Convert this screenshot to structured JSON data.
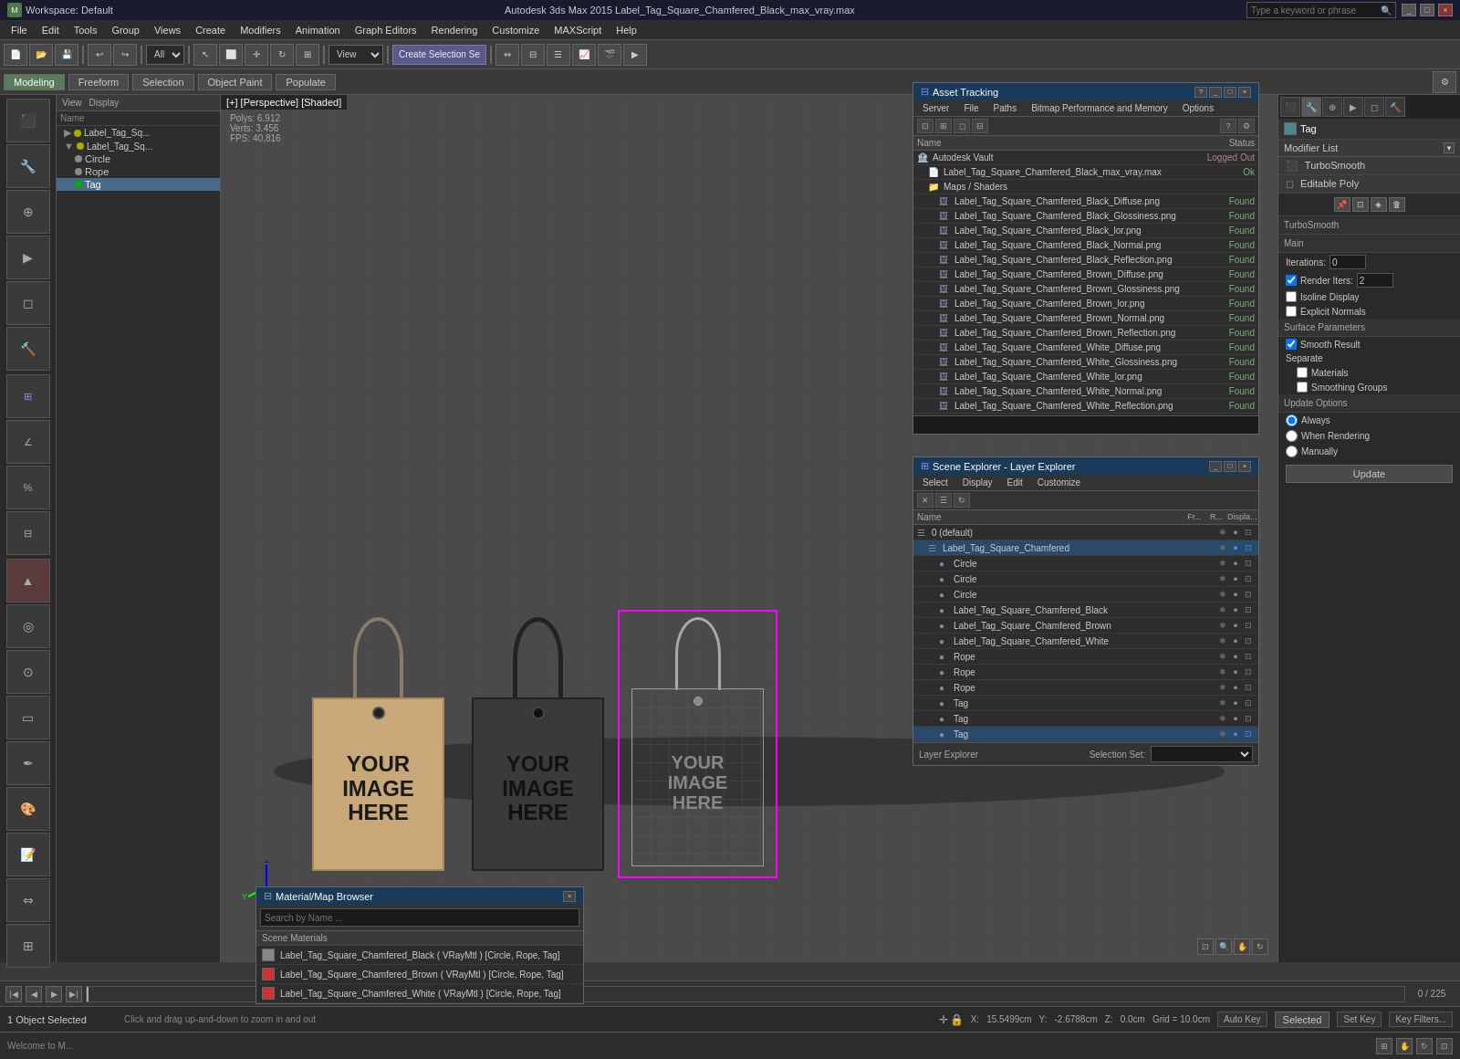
{
  "titleBar": {
    "leftLabel": "Workspace: Default",
    "centerLabel": "Autodesk 3ds Max 2015  Label_Tag_Square_Chamfered_Black_max_vray.max",
    "searchPlaceholder": "Type a keyword or phrase",
    "winBtns": [
      "_",
      "□",
      "×"
    ]
  },
  "menuBar": {
    "items": [
      "File",
      "Edit",
      "Tools",
      "Group",
      "Views",
      "Create",
      "Modifiers",
      "Animation",
      "Graph Editors",
      "Rendering",
      "Customize",
      "MAXScript",
      "Help"
    ]
  },
  "toolbar": {
    "createSelectionLabel": "Create Selection Se",
    "viewLabel": "View",
    "allLabel": "All"
  },
  "tabs": {
    "modeling": "Modeling",
    "freeform": "Freeform",
    "selection": "Selection",
    "objectPaint": "Object Paint",
    "populate": "Populate"
  },
  "scenePanel": {
    "viewLabel": "View",
    "displayLabel": "Display",
    "items": [
      {
        "id": "item1",
        "label": "Label_Tag_Sq...",
        "depth": 0,
        "hasIcon": true
      },
      {
        "id": "item2",
        "label": "Label_Tag_Sq...",
        "depth": 0,
        "hasIcon": true
      },
      {
        "id": "item3",
        "label": "Circle",
        "depth": 2,
        "selected": false
      },
      {
        "id": "item4",
        "label": "Rope",
        "depth": 2,
        "selected": false
      },
      {
        "id": "item5",
        "label": "Tag",
        "depth": 2,
        "selected": true
      }
    ]
  },
  "viewport": {
    "header": "[+] [Perspective] [Shaded]",
    "stats": {
      "polysLabel": "Polys:",
      "polysValue": "6.912",
      "vertsLabel": "Verts:",
      "vertsValue": "3.456",
      "fpsLabel": "FPS:",
      "fpsValue": "40,816"
    },
    "tags": [
      {
        "type": "brown",
        "text": "YOUR\nIMAGE\nHERE"
      },
      {
        "type": "dark",
        "text": "YOUR\nIMAGE\nHERE"
      },
      {
        "type": "wireframe",
        "text": "YOUR\nIMAGE\nHERE"
      }
    ]
  },
  "assetTracking": {
    "title": "Asset Tracking",
    "menuItems": [
      "Server",
      "File",
      "Paths",
      "Bitmap Performance and Memory",
      "Options"
    ],
    "tableHeaders": {
      "name": "Name",
      "status": "Status"
    },
    "rows": [
      {
        "type": "vault",
        "name": "Autodesk Vault",
        "status": "Logged Out",
        "indent": 0
      },
      {
        "type": "file",
        "name": "Label_Tag_Square_Chamfered_Black_max_vray.max",
        "status": "Ok",
        "indent": 1
      },
      {
        "type": "section",
        "name": "Maps / Shaders",
        "status": "",
        "indent": 1
      },
      {
        "type": "map",
        "name": "Label_Tag_Square_Chamfered_Black_Diffuse.png",
        "status": "Found",
        "indent": 2
      },
      {
        "type": "map",
        "name": "Label_Tag_Square_Chamfered_Black_Glossiness.png",
        "status": "Found",
        "indent": 2
      },
      {
        "type": "map",
        "name": "Label_Tag_Square_Chamfered_Black_lor.png",
        "status": "Found",
        "indent": 2
      },
      {
        "type": "map",
        "name": "Label_Tag_Square_Chamfered_Black_Normal.png",
        "status": "Found",
        "indent": 2
      },
      {
        "type": "map",
        "name": "Label_Tag_Square_Chamfered_Black_Reflection.png",
        "status": "Found",
        "indent": 2
      },
      {
        "type": "map",
        "name": "Label_Tag_Square_Chamfered_Brown_Diffuse.png",
        "status": "Found",
        "indent": 2
      },
      {
        "type": "map",
        "name": "Label_Tag_Square_Chamfered_Brown_Glossiness.png",
        "status": "Found",
        "indent": 2
      },
      {
        "type": "map",
        "name": "Label_Tag_Square_Chamfered_Brown_lor.png",
        "status": "Found",
        "indent": 2
      },
      {
        "type": "map",
        "name": "Label_Tag_Square_Chamfered_Brown_Normal.png",
        "status": "Found",
        "indent": 2
      },
      {
        "type": "map",
        "name": "Label_Tag_Square_Chamfered_Brown_Reflection.png",
        "status": "Found",
        "indent": 2
      },
      {
        "type": "map",
        "name": "Label_Tag_Square_Chamfered_White_Diffuse.png",
        "status": "Found",
        "indent": 2
      },
      {
        "type": "map",
        "name": "Label_Tag_Square_Chamfered_White_Glossiness.png",
        "status": "Found",
        "indent": 2
      },
      {
        "type": "map",
        "name": "Label_Tag_Square_Chamfered_White_lor.png",
        "status": "Found",
        "indent": 2
      },
      {
        "type": "map",
        "name": "Label_Tag_Square_Chamfered_White_Normal.png",
        "status": "Found",
        "indent": 2
      },
      {
        "type": "map",
        "name": "Label_Tag_Square_Chamfered_White_Reflection.png",
        "status": "Found",
        "indent": 2
      }
    ]
  },
  "sceneExplorer": {
    "title": "Scene Explorer - Layer Explorer",
    "menuItems": [
      "Select",
      "Display",
      "Edit",
      "Customize"
    ],
    "tableHeaders": {
      "name": "Name",
      "fr": "Fr...",
      "r": "R...",
      "display": "Displa..."
    },
    "rows": [
      {
        "name": "0 (default)",
        "depth": 0,
        "type": "layer",
        "selected": false
      },
      {
        "name": "Label_Tag_Square_Chamfered",
        "depth": 1,
        "type": "layer",
        "selected": false,
        "highlighted": true
      },
      {
        "name": "Circle",
        "depth": 2,
        "type": "obj",
        "selected": false
      },
      {
        "name": "Circle",
        "depth": 2,
        "type": "obj",
        "selected": false
      },
      {
        "name": "Circle",
        "depth": 2,
        "type": "obj",
        "selected": false
      },
      {
        "name": "Label_Tag_Square_Chamfered_Black",
        "depth": 2,
        "type": "obj",
        "selected": false
      },
      {
        "name": "Label_Tag_Square_Chamfered_Brown",
        "depth": 2,
        "type": "obj",
        "selected": false
      },
      {
        "name": "Label_Tag_Square_Chamfered_White",
        "depth": 2,
        "type": "obj",
        "selected": false
      },
      {
        "name": "Rope",
        "depth": 2,
        "type": "obj",
        "selected": false
      },
      {
        "name": "Rope",
        "depth": 2,
        "type": "obj",
        "selected": false
      },
      {
        "name": "Rope",
        "depth": 2,
        "type": "obj",
        "selected": false
      },
      {
        "name": "Tag",
        "depth": 2,
        "type": "obj",
        "selected": false
      },
      {
        "name": "Tag",
        "depth": 2,
        "type": "obj",
        "selected": false
      },
      {
        "name": "Tag",
        "depth": 2,
        "type": "obj",
        "selected": true,
        "highlighted": true
      }
    ],
    "footer": {
      "label": "Layer Explorer",
      "selectionSetLabel": "Selection Set:",
      "selectionSetValue": ""
    }
  },
  "matBrowser": {
    "title": "Material/Map Browser",
    "searchPlaceholder": "Search by Name ...",
    "sectionLabel": "Scene Materials",
    "materials": [
      {
        "name": "Label_Tag_Square_Chamfered_Black ( VRayMtl ) [Circle, Rope, Tag]",
        "color": "gray"
      },
      {
        "name": "Label_Tag_Square_Chamfered_Brown ( VRayMtl ) [Circle, Rope, Tag]",
        "color": "red"
      },
      {
        "name": "Label_Tag_Square_Chamfered_White ( VRayMtl ) [Circle, Rope, Tag]",
        "color": "red"
      }
    ]
  },
  "rightPanel": {
    "tag": "Tag",
    "modifierListLabel": "Modifier List",
    "modifiers": [
      {
        "name": "TurboSmooth"
      },
      {
        "name": "Editable Poly"
      }
    ],
    "turboSmooth": {
      "title": "TurboSmooth",
      "main": "Main",
      "iterationsLabel": "Iterations:",
      "iterationsValue": "0",
      "renderItersLabel": "Render Iters:",
      "renderItersValue": "2",
      "isoLineDisplay": "Isoline Display",
      "explicitNormals": "Explicit Normals",
      "surfaceParams": "Surface Parameters",
      "smoothResult": "Smooth Result",
      "separate": "Separate",
      "materials": "Materials",
      "smoothingGroups": "Smoothing Groups",
      "updateOptions": "Update Options",
      "always": "Always",
      "whenRendering": "When Rendering",
      "manually": "Manually",
      "updateBtn": "Update"
    }
  },
  "statusBar": {
    "objectSelected": "1 Object Selected",
    "tip": "Click and drag up-and-down to zoom in and out",
    "welcomeLabel": "Welcome to M...",
    "coords": {
      "x": "15.5499cm",
      "y": "-2.6788cm",
      "z": "0.0cm"
    },
    "grid": "Grid = 10.0cm",
    "autoKeyLabel": "Auto Key",
    "selectedLabel": "Selected",
    "setKeyLabel": "Set Key",
    "keyFilters": "Key Filters...",
    "timePosition": "0 / 225"
  },
  "icons": {
    "folder": "📁",
    "file": "📄",
    "map": "🖼",
    "layer": "◻",
    "object": "●",
    "lock": "🔒",
    "eye": "👁",
    "sun": "☀",
    "gear": "⚙",
    "arrow": "▶",
    "arrowDown": "▼",
    "arrowRight": "▶",
    "plus": "+",
    "minus": "-",
    "close": "×",
    "minimize": "_",
    "maximize": "□",
    "help": "?"
  }
}
